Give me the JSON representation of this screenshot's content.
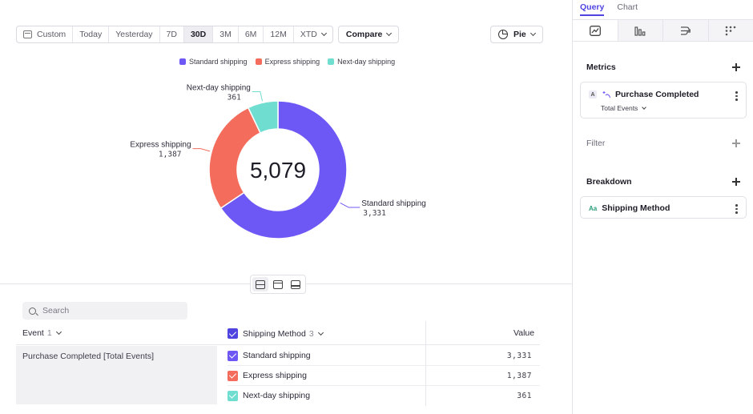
{
  "toolbar": {
    "custom_label": "Custom",
    "ranges": [
      "Today",
      "Yesterday",
      "7D",
      "30D",
      "3M",
      "6M",
      "12M",
      "XTD"
    ],
    "active_range": "30D",
    "compare_label": "Compare",
    "chart_type_label": "Pie"
  },
  "chart_data": {
    "type": "pie",
    "categories": [
      "Standard shipping",
      "Express shipping",
      "Next-day shipping"
    ],
    "values": [
      3331,
      1387,
      361
    ],
    "value_labels": [
      "3,331",
      "1,387",
      "361"
    ],
    "total_label": "5,079",
    "colors": [
      "#6e58f5",
      "#f36c5c",
      "#6fddd0"
    ],
    "donut": true,
    "legend_position": "top"
  },
  "table": {
    "search_placeholder": "Search",
    "event_header": "Event",
    "event_count": "1",
    "breakdown_header": "Shipping Method",
    "breakdown_count": "3",
    "value_header": "Value",
    "event_name": "Purchase Completed [Total Events]",
    "rows": [
      {
        "label": "Standard shipping",
        "value": "3,331",
        "color": "#6e58f5"
      },
      {
        "label": "Express shipping",
        "value": "1,387",
        "color": "#f36c5c"
      },
      {
        "label": "Next-day shipping",
        "value": "361",
        "color": "#6fddd0"
      }
    ]
  },
  "sidebar": {
    "tabs": [
      "Query",
      "Chart"
    ],
    "metrics_title": "Metrics",
    "metric_badge": "A",
    "metric_name": "Purchase Completed",
    "metric_sub": "Total Events",
    "filter_title": "Filter",
    "breakdown_title": "Breakdown",
    "breakdown_badge": "Aa",
    "breakdown_name": "Shipping Method",
    "accent": "#4f44e0"
  }
}
